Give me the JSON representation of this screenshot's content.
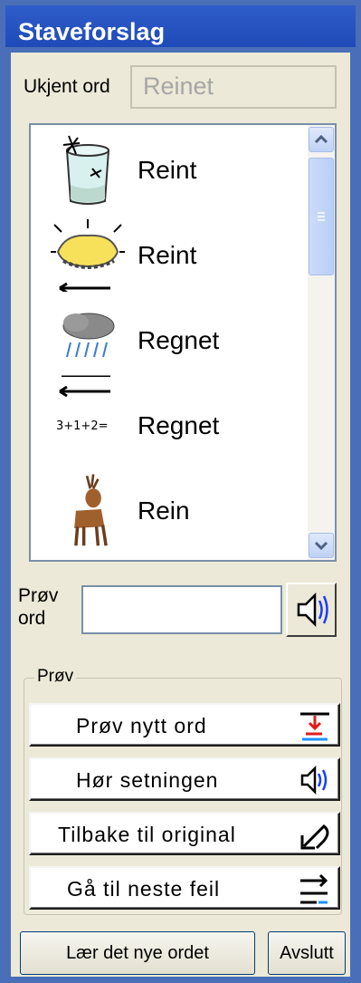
{
  "window": {
    "title": "Staveforslag"
  },
  "unknown_word": {
    "label": "Ukjent ord",
    "value": "Reinet"
  },
  "suggestions": [
    {
      "word": "Reint",
      "icon": "glass-icon"
    },
    {
      "word": "Reint",
      "icon": "clean-sparkle-icon"
    },
    {
      "word": "Regnet",
      "icon": "rain-cloud-icon"
    },
    {
      "word": "Regnet",
      "icon": "math-calculation-icon"
    },
    {
      "word": "Rein",
      "icon": "reindeer-icon"
    }
  ],
  "try_word": {
    "label_line1": "Prøv",
    "label_line2": "ord",
    "value": ""
  },
  "try_group": {
    "title": "Prøv",
    "buttons": [
      {
        "label": "Prøv nytt ord",
        "icon": "insert-word-icon"
      },
      {
        "label": "Hør setningen",
        "icon": "speaker-icon"
      },
      {
        "label": "Tilbake til original",
        "icon": "undo-arrow-icon"
      },
      {
        "label": "Gå til neste feil",
        "icon": "next-error-icon"
      }
    ]
  },
  "footer": {
    "learn_label": "Lær det nye ordet",
    "close_label": "Avslutt"
  },
  "colors": {
    "title_bar": "#2355c6",
    "window_bg": "#ece9d8",
    "accent_red": "#e11d1d",
    "accent_blue": "#1e90ff"
  }
}
